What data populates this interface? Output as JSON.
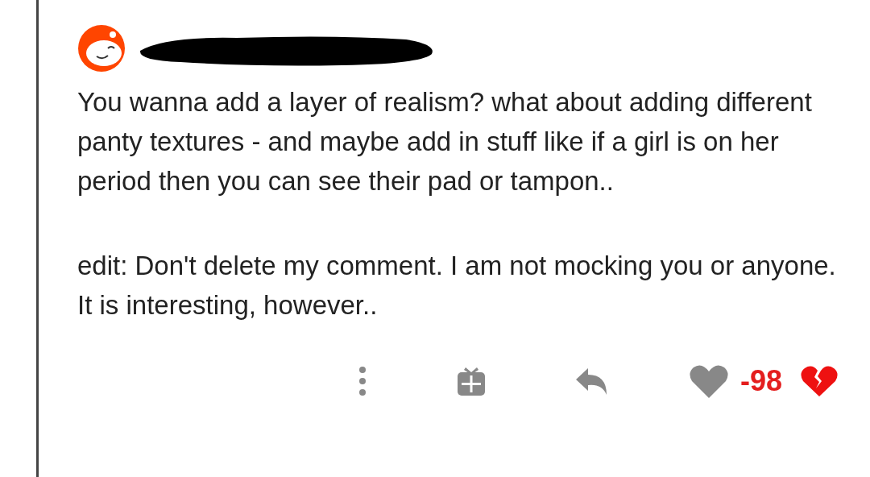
{
  "comment": {
    "username_redacted": true,
    "paragraphs": [
      "You wanna add a layer of realism? what about adding different panty textures - and maybe add in stuff like if a girl is on her period then you can see their pad or tampon..",
      "edit: Don't delete my comment. I am not mocking you or anyone. It is interesting, however.."
    ],
    "score": "-98",
    "downvoted": true
  }
}
